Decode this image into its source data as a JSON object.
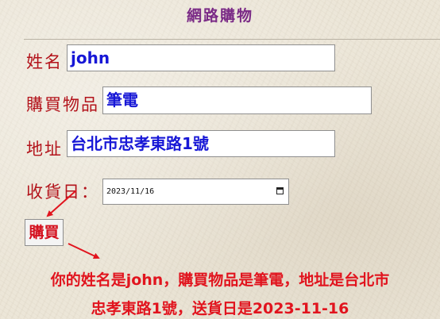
{
  "page": {
    "title": "網路購物"
  },
  "form": {
    "name": {
      "label": "姓名",
      "value": "john"
    },
    "item": {
      "label": "購買物品",
      "value": "筆電"
    },
    "address": {
      "label": "地址",
      "value": "台北市忠孝東路1號"
    },
    "delivery_date": {
      "label": "收貨日：",
      "value": "2023/11/16",
      "icon": "calendar-icon"
    },
    "submit_label": "購買"
  },
  "result": {
    "line1": "你的姓名是john，購買物品是筆電，地址是台北市",
    "line2": "忠孝東路1號，送貨日是2023-11-16"
  },
  "colors": {
    "title": "#7a2a86",
    "label": "#b3131b",
    "input_text": "#1717d6",
    "result_text": "#e1141e",
    "annotation_arrow": "#e1141e"
  }
}
